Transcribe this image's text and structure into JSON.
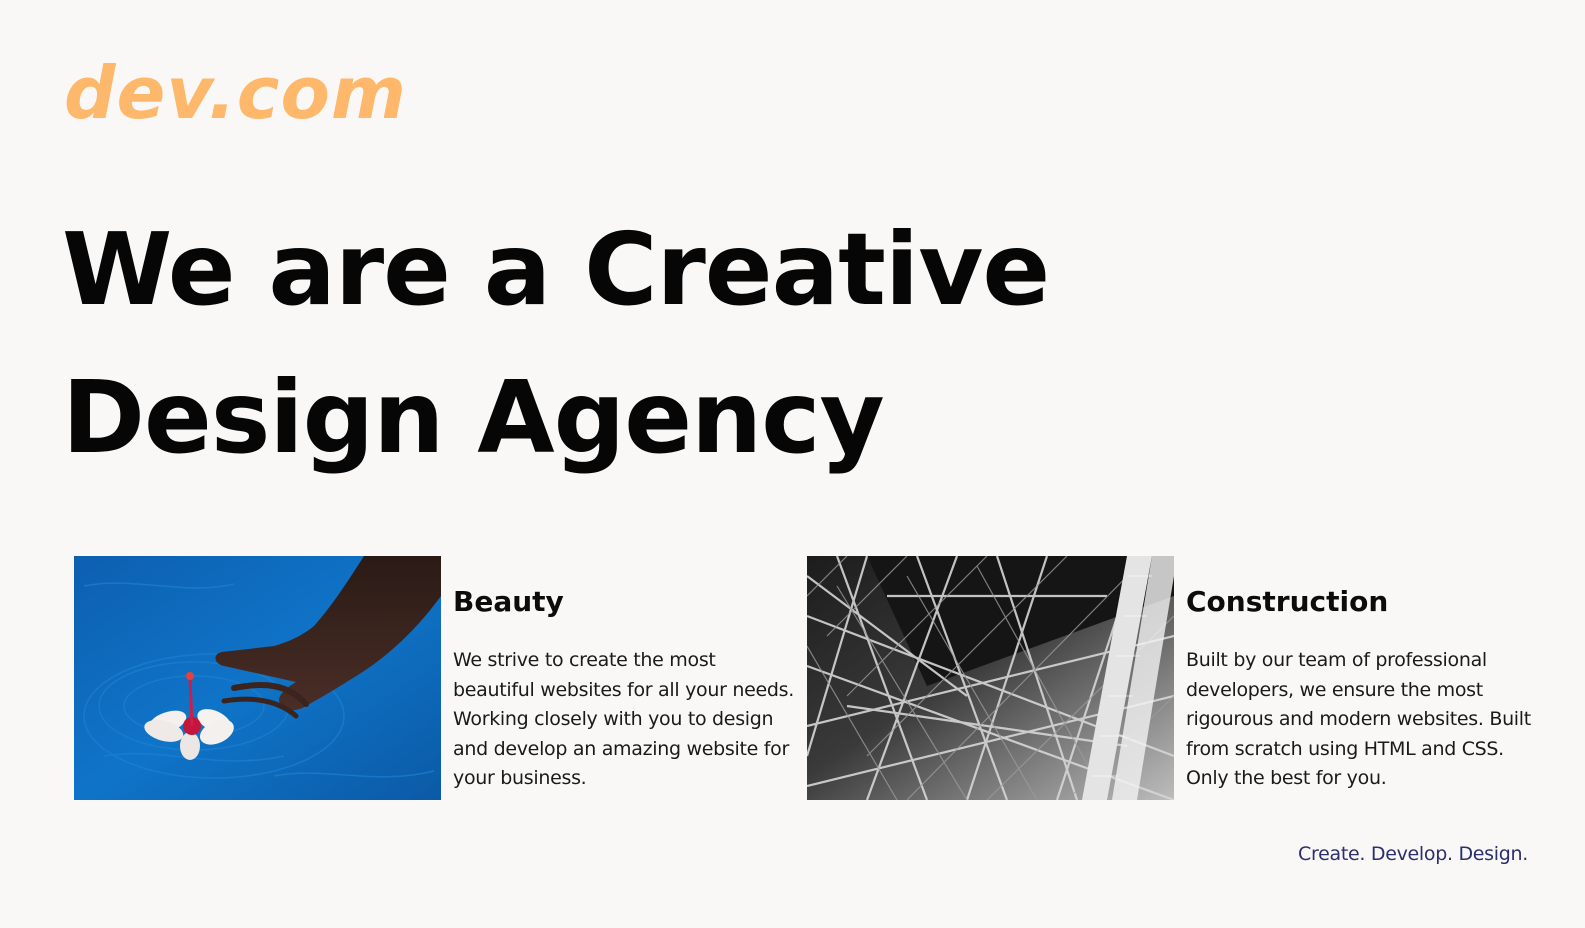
{
  "logo": "dev.com",
  "headline": "We are a Creative Design Agency",
  "cards": [
    {
      "title": "Beauty",
      "text": "We strive to create the most beautiful websites for all your needs. Working closely with you to design and develop an amazing website for your business.",
      "image": "hand-flower-water-photo"
    },
    {
      "title": "Construction",
      "text": "Built by our team of professional developers, we ensure the most rigourous and modern websites. Built from scratch using HTML and CSS. Only the best for you.",
      "image": "steel-structure-photo"
    }
  ],
  "tagline": "Create. Develop. Design.",
  "colors": {
    "background": "#faf8f6",
    "logo": "#fdb86b",
    "headline": "#060606",
    "tagline": "#2b2f6b"
  }
}
